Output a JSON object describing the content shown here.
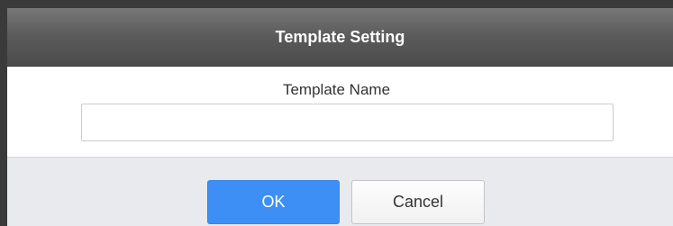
{
  "dialog": {
    "title": "Template Setting",
    "field_label": "Template Name",
    "field_value": "",
    "field_placeholder": "",
    "ok_label": "OK",
    "cancel_label": "Cancel"
  },
  "colors": {
    "title_bar": "#555555",
    "footer": "#e8eaed",
    "ok_button": "#3d8ff5",
    "cancel_button": "#f5f5f5"
  }
}
